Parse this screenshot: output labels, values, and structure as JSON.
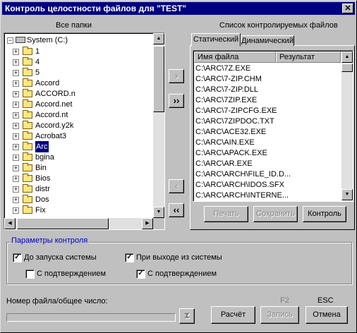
{
  "window": {
    "title": "Контроль целостности файлов для \"TEST\"",
    "close_glyph": "✕"
  },
  "left_panel": {
    "caption": "Все папки",
    "root": "System (C:)",
    "folders": [
      "1",
      "4",
      "5",
      "Accord",
      "ACCORD.n",
      "Accord.net",
      "Accord.nt",
      "Accord.y2k",
      "Acrobat3",
      "Arc",
      "bgina",
      "Bin",
      "Bios",
      "distr",
      "Dos",
      "Fix"
    ],
    "selected_folder": "Arc",
    "expander_glyph": "+",
    "root_expander_glyph": "−"
  },
  "transfer_buttons": {
    "add_one": "›",
    "add_all": "››",
    "remove_one": "‹",
    "remove_all": "‹‹"
  },
  "right_panel": {
    "caption": "Список контролируемых файлов",
    "tabs": [
      "Статический",
      "Динамический"
    ],
    "active_tab": "Статический",
    "columns": [
      "Имя файла",
      "Результат"
    ],
    "files": [
      "C:\\ARC\\7Z.EXE",
      "C:\\ARC\\7-ZIP.CHM",
      "C:\\ARC\\7-ZIP.DLL",
      "C:\\ARC\\7ZIP.EXE",
      "C:\\ARC\\7-ZIPCFG.EXE",
      "C:\\ARC\\7ZIPDOC.TXT",
      "C:\\ARC\\ACE32.EXE",
      "C:\\ARC\\AIN.EXE",
      "C:\\ARC\\APACK.EXE",
      "C:\\ARC\\AR.EXE",
      "C:\\ARC\\ARCH\\FILE_ID.D...",
      "C:\\ARC\\ARCH\\IDOS.SFX",
      "C:\\ARC\\ARCH\\INTERNE..."
    ],
    "buttons": {
      "print": "Печать",
      "save": "Сохранить",
      "control": "Контроль"
    }
  },
  "control_params": {
    "title": "Параметры контроля",
    "before_start": {
      "label": "До запуска системы",
      "checked": true
    },
    "before_start_confirm": {
      "label": "С подтверждением",
      "checked": false
    },
    "on_exit": {
      "label": "При выходе из системы",
      "checked": true
    },
    "on_exit_confirm": {
      "label": "С подтверждением",
      "checked": true
    },
    "check_glyph": "✓"
  },
  "bottom": {
    "progress_label": "Номер файла/общее число:",
    "progress_value": 0,
    "hotkey_f2": "F2",
    "hotkey_esc": "ESC",
    "calculate": "Расчёт",
    "write": "Запись",
    "cancel": "Отмена"
  }
}
